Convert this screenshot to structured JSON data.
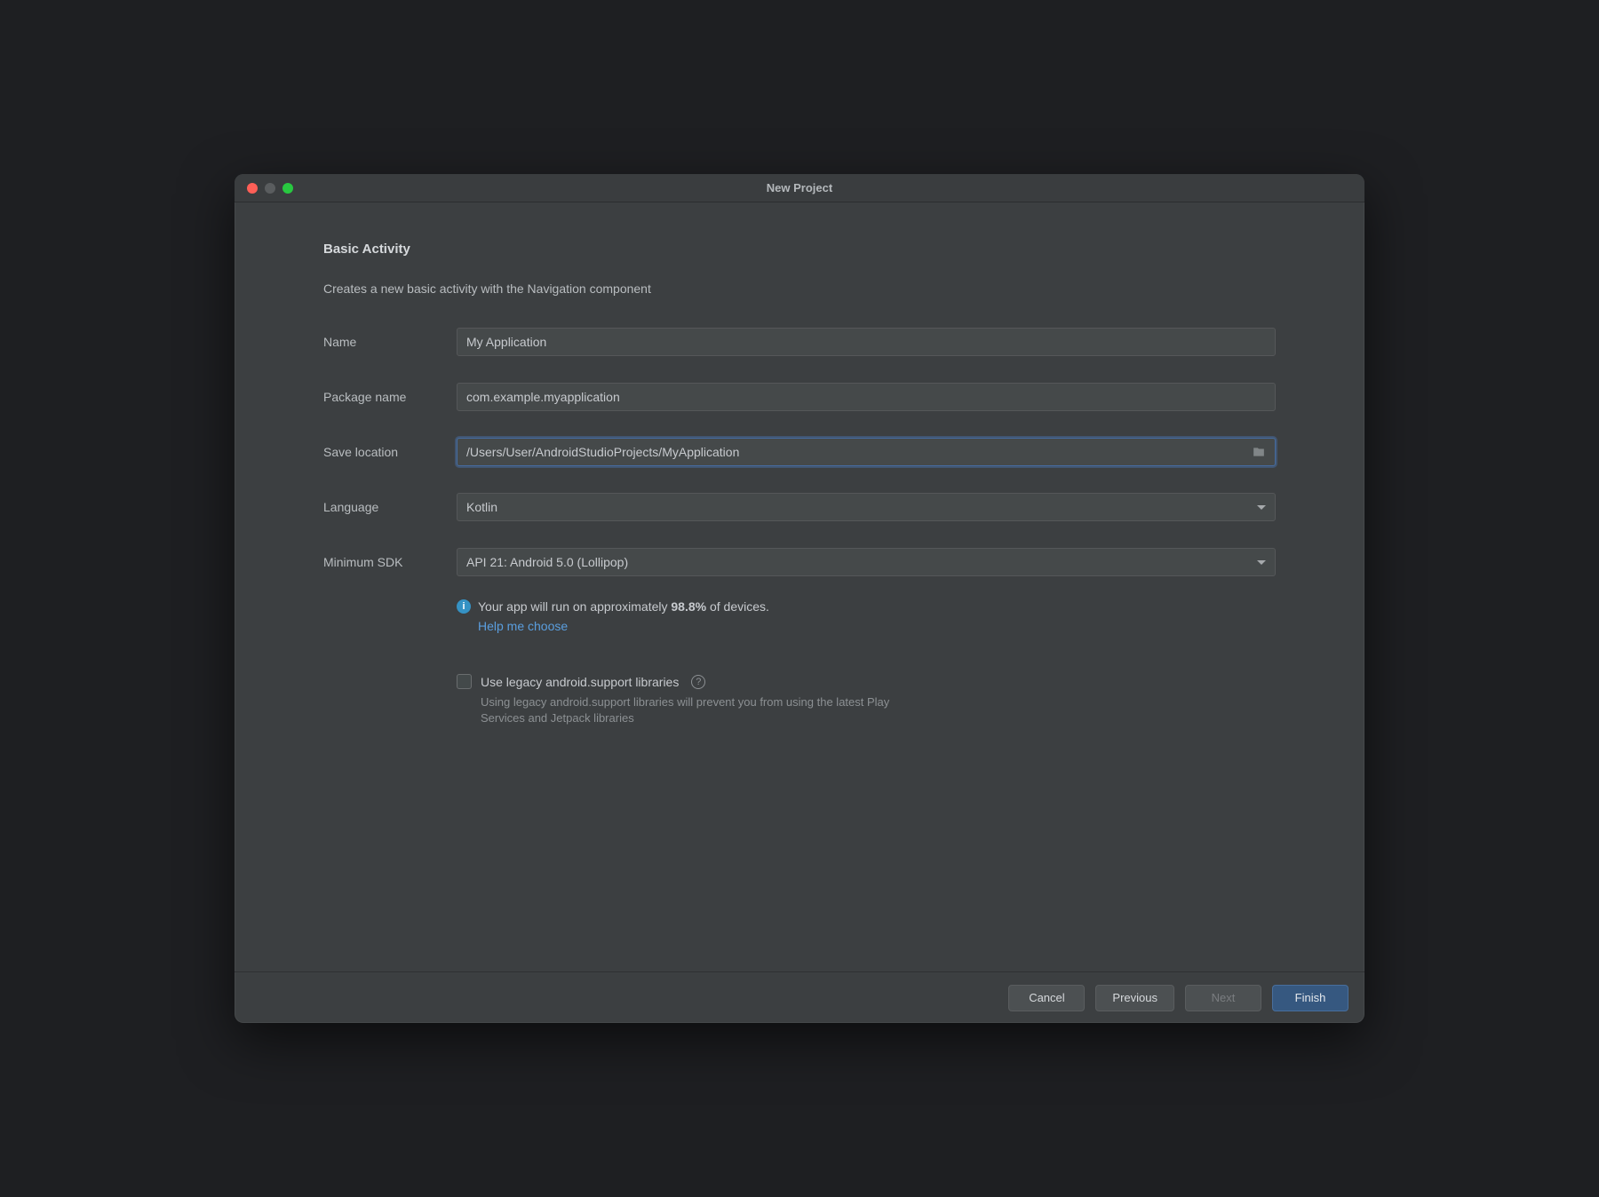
{
  "window": {
    "title": "New Project"
  },
  "page": {
    "heading": "Basic Activity",
    "description": "Creates a new basic activity with the Navigation component"
  },
  "form": {
    "name": {
      "label": "Name",
      "value": "My Application"
    },
    "package": {
      "label": "Package name",
      "value": "com.example.myapplication"
    },
    "location": {
      "label": "Save location",
      "value": "/Users/User/AndroidStudioProjects/MyApplication"
    },
    "language": {
      "label": "Language",
      "value": "Kotlin"
    },
    "minsdk": {
      "label": "Minimum SDK",
      "value": "API 21: Android 5.0 (Lollipop)"
    }
  },
  "info": {
    "prefix": "Your app will run on approximately ",
    "bold": "98.8%",
    "suffix": " of devices.",
    "help_link": "Help me choose"
  },
  "legacy": {
    "label": "Use legacy android.support libraries",
    "hint": "Using legacy android.support libraries will prevent you from using the latest Play Services and Jetpack libraries"
  },
  "buttons": {
    "cancel": "Cancel",
    "previous": "Previous",
    "next": "Next",
    "finish": "Finish"
  }
}
